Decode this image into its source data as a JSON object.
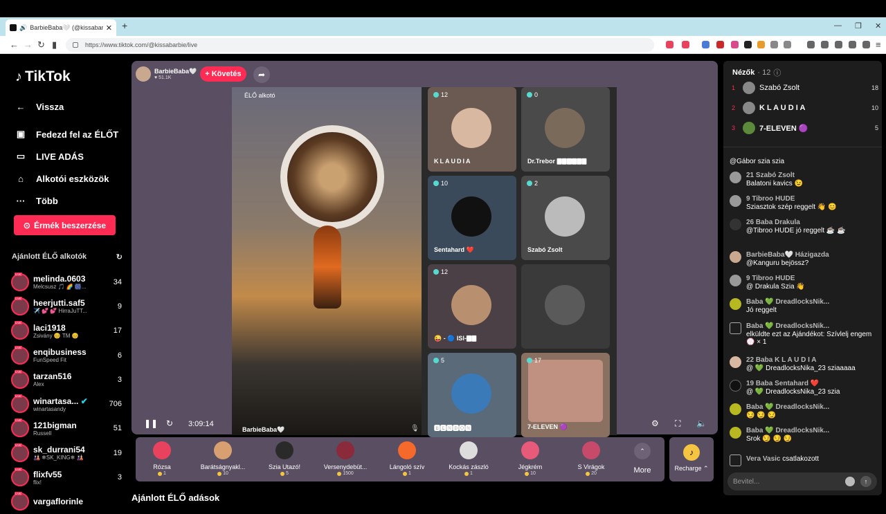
{
  "browser": {
    "tab_title": "BarbieBaba🤍 (@kissabarbie",
    "url": "https://www.tiktok.com/@kissabarbie/live"
  },
  "sidebar": {
    "logo": "TikTok",
    "nav": [
      {
        "label": "Vissza"
      },
      {
        "label": "Fedezd fel az ÉLŐT"
      },
      {
        "label": "LIVE ADÁS"
      },
      {
        "label": "Alkotói eszközök"
      },
      {
        "label": "Több"
      }
    ],
    "coins_label": "Érmék beszerzése",
    "rec_header": "Ajánlott ÉLŐ alkotók",
    "recs": [
      {
        "name": "melinda.0603",
        "sub": "Melcsusz 🎵 🌈 🎆...",
        "count": "34"
      },
      {
        "name": "heerjutti.saf5",
        "sub": "✈️ 💕 💕 HirraJuTT...",
        "count": "9"
      },
      {
        "name": "laci1918",
        "sub": "Zsivány 😊 TM 😊",
        "count": "17"
      },
      {
        "name": "enqibusiness",
        "sub": "FunSpeed Fit",
        "count": "6"
      },
      {
        "name": "tarzan516",
        "sub": "Alex",
        "count": "3"
      },
      {
        "name": "winartasa...",
        "sub": "winartasandy",
        "count": "706"
      },
      {
        "name": "121bigman",
        "sub": "Russell",
        "count": "51"
      },
      {
        "name": "sk_durrani54",
        "sub": "🎎 ❄SK_KING❄ 🎎",
        "count": "19"
      },
      {
        "name": "flixfv55",
        "sub": "flix!",
        "count": "3"
      },
      {
        "name": "vargaflorinle",
        "sub": "",
        "count": ""
      }
    ]
  },
  "stage": {
    "host_name": "BarbieBaba🤍",
    "host_likes": "51.1K",
    "follow": "+ Követés",
    "elo_label": "ÉLŐ alkotó",
    "main_name": "BarbieBaba🤍",
    "time": "3:09:14",
    "guests": [
      {
        "name": "KLAUDIA",
        "count": "12"
      },
      {
        "name": "Dr.Trebor 🀫🀫🀫🀫🀫🀫",
        "count": "0"
      },
      {
        "name": "Sentahard ❤️",
        "count": "10"
      },
      {
        "name": "Szabó Zsolt",
        "count": "2"
      },
      {
        "name": "😜 - 🔵 ISI-🀫🀫",
        "count": "12"
      },
      {
        "name": "",
        "count": ""
      },
      {
        "name": "🅱🅴🅽🅳🅾🅽",
        "count": "5"
      },
      {
        "name": "7-ELEVEN 🟣",
        "count": "17"
      }
    ]
  },
  "gifts": [
    {
      "label": "Rózsa",
      "price": "1"
    },
    {
      "label": "Barátságnyakl...",
      "price": "10"
    },
    {
      "label": "Szia Utazó!",
      "price": "5"
    },
    {
      "label": "Versenydebüt...",
      "price": "1500"
    },
    {
      "label": "Lángoló szív",
      "price": "1"
    },
    {
      "label": "Kockás zászló",
      "price": "1"
    },
    {
      "label": "Jégkrém",
      "price": "10"
    },
    {
      "label": "S Virágok",
      "price": "20"
    }
  ],
  "more_label": "More",
  "recharge_label": "Recharge ⌃",
  "bottom_header": "Ajánlott ÉLŐ adások",
  "chat": {
    "viewers_label": "Nézők",
    "viewers_count": "· 12",
    "top": [
      {
        "rank": "1",
        "name": "Szabó Zsolt",
        "score": "18"
      },
      {
        "rank": "2",
        "name": "K L A U D I A",
        "score": "10"
      },
      {
        "rank": "3",
        "name": "7-ELEVEN 🟣",
        "score": "5"
      }
    ],
    "messages": [
      {
        "name": "",
        "text": "@Gábor szia szia"
      },
      {
        "name": "21 Szabó Zsolt",
        "text": "Balatoni kavics 😉"
      },
      {
        "name": "9 Tibroo HUDE",
        "text": "Sziasztok szép reggelt 👋 😊"
      },
      {
        "name": "26 Baba Drakula",
        "text": "@Tibroo HUDE jó reggelt ☕ ☕"
      },
      {
        "name": "BarbieBaba🤍 Házigazda",
        "text": "@Kanguru bejössz?"
      },
      {
        "name": "9 Tibroo HUDE",
        "text": "@ Drakula Szia 👋"
      },
      {
        "name": "Baba 💚 DreadlocksNik...",
        "text": "Jó reggelt"
      },
      {
        "name": "Baba 💚 DreadlocksNik...",
        "text": "elküldte ezt az Ajándékot: Szívlelj engem 💮 × 1"
      },
      {
        "name": "22 Baba K L A U D I A",
        "text": "@ 💚 DreadlocksNika_23 sziaaaaa"
      },
      {
        "name": "19 Baba Sentahard ❤️",
        "text": "@ 💚 DreadlocksNika_23 szia"
      },
      {
        "name": "Baba 💚 DreadlocksNik...",
        "text": "😏 😏 😏"
      },
      {
        "name": "Baba 💚 DreadlocksNik...",
        "text": "Srok 😏 😏 😏"
      },
      {
        "name": "Vera Vasic",
        "text": "csatlakozott"
      }
    ],
    "input_placeholder": "Bevitel..."
  }
}
